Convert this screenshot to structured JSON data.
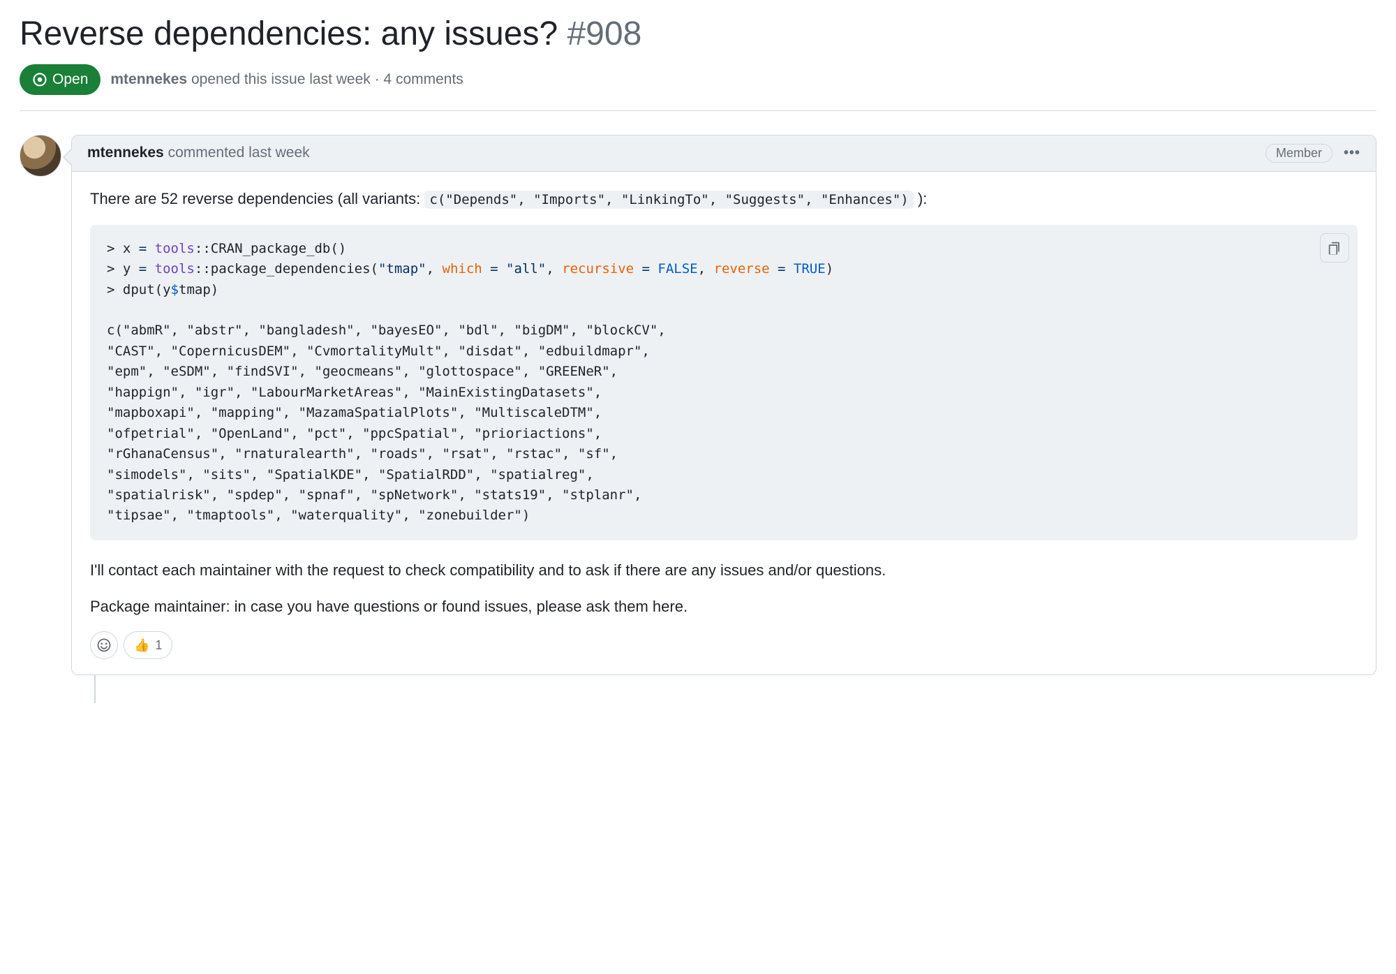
{
  "issue": {
    "title": "Reverse dependencies: any issues?",
    "number": "#908",
    "state": "Open",
    "author": "mtennekes",
    "opened_text": "opened this issue last week",
    "comments_text": "· 4 comments"
  },
  "comment": {
    "author": "mtennekes",
    "timestamp_text": "commented last week",
    "badge": "Member",
    "intro_prefix": "There are 52 reverse dependencies (all variants: ",
    "intro_code": "c(\"Depends\", \"Imports\", \"LinkingTo\", \"Suggests\", \"Enhances\")",
    "intro_suffix": " ):",
    "code": {
      "l1p": "> ",
      "l1v": "x",
      "l1e": " = ",
      "l1m": "tools",
      "l1c": "::",
      "l1f": "CRAN_package_db()",
      "l2p": "> ",
      "l2v": "y",
      "l2e": " = ",
      "l2m": "tools",
      "l2c": "::",
      "l2f": "package_dependencies(",
      "l2s": "\"tmap\"",
      "l2a1n": "which",
      "l2a1e": " = ",
      "l2a1v": "\"all\"",
      "l2a2n": "recursive",
      "l2a2e": " = ",
      "l2a2v": "FALSE",
      "l2a3n": "reverse",
      "l2a3e": " = ",
      "l2a3v": "TRUE",
      "l2end": ")",
      "l3p": "> ",
      "l3f": "dput(",
      "l3v": "y",
      "l3d": "$",
      "l3fld": "tmap",
      "l3end": ")",
      "out1": "c(\"abmR\", \"abstr\", \"bangladesh\", \"bayesEO\", \"bdl\", \"bigDM\", \"blockCV\", ",
      "out2": "\"CAST\", \"CopernicusDEM\", \"CvmortalityMult\", \"disdat\", \"edbuildmapr\", ",
      "out3": "\"epm\", \"eSDM\", \"findSVI\", \"geocmeans\", \"glottospace\", \"GREENeR\", ",
      "out4": "\"happign\", \"igr\", \"LabourMarketAreas\", \"MainExistingDatasets\", ",
      "out5": "\"mapboxapi\", \"mapping\", \"MazamaSpatialPlots\", \"MultiscaleDTM\", ",
      "out6": "\"ofpetrial\", \"OpenLand\", \"pct\", \"ppcSpatial\", \"prioriactions\", ",
      "out7": "\"rGhanaCensus\", \"rnaturalearth\", \"roads\", \"rsat\", \"rstac\", \"sf\", ",
      "out8": "\"simodels\", \"sits\", \"SpatialKDE\", \"SpatialRDD\", \"spatialreg\", ",
      "out9": "\"spatialrisk\", \"spdep\", \"spnaf\", \"spNetwork\", \"stats19\", \"stplanr\", ",
      "out10": "\"tipsae\", \"tmaptools\", \"waterquality\", \"zonebuilder\")"
    },
    "para1": "I'll contact each maintainer with the request to check compatibility and to ask if there are any issues and/or questions.",
    "para2": "Package maintainer: in case you have questions or found issues, please ask them here.",
    "reaction_emoji": "👍",
    "reaction_count": "1"
  }
}
